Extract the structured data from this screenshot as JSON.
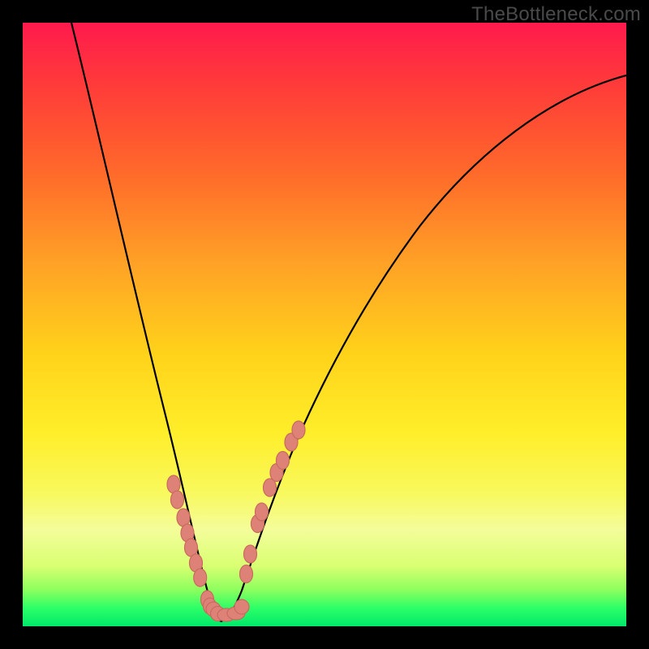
{
  "watermark": "TheBottleneck.com",
  "colors": {
    "frame": "#000000",
    "gradient_top": "#ff1a4d",
    "gradient_bottom": "#00e86a",
    "curve": "#000000",
    "marker_fill": "#de8277",
    "marker_stroke": "#c96a5f"
  },
  "chart_data": {
    "type": "line",
    "title": "",
    "xlabel": "",
    "ylabel": "",
    "xlim": [
      0,
      100
    ],
    "ylim": [
      0,
      100
    ],
    "series": [
      {
        "name": "left-curve",
        "x": [
          8,
          10,
          12,
          14,
          16,
          18,
          20,
          22,
          23,
          24,
          25,
          26,
          27,
          28,
          29,
          30,
          31,
          32
        ],
        "y": [
          100,
          88,
          77,
          67,
          58,
          49,
          41,
          33,
          29,
          25,
          21,
          17,
          14,
          11,
          8,
          5,
          3,
          2
        ]
      },
      {
        "name": "right-curve",
        "x": [
          32,
          33,
          34,
          35,
          36,
          37,
          38,
          40,
          42,
          45,
          48,
          52,
          56,
          60,
          65,
          70,
          76,
          82,
          88,
          94,
          100
        ],
        "y": [
          2,
          3,
          5,
          8,
          11,
          14,
          17,
          22,
          27,
          33,
          39,
          46,
          52,
          57,
          63,
          68,
          73,
          77,
          80,
          83,
          85
        ]
      },
      {
        "name": "markers-left-cluster",
        "x": [
          25.0,
          25.6,
          26.6,
          27.3,
          27.9,
          28.7,
          29.4,
          30.6,
          31.0,
          31.6,
          32.3,
          33.0
        ],
        "y": [
          23.5,
          21.0,
          18.0,
          15.5,
          13.0,
          10.5,
          8.0,
          4.5,
          3.4,
          2.8,
          2.1,
          2.0
        ]
      },
      {
        "name": "markers-right-cluster",
        "x": [
          34.3,
          35.0,
          37.0,
          37.7,
          38.9,
          39.6,
          40.9,
          42.1,
          43.1,
          44.5,
          45.7
        ],
        "y": [
          2.0,
          3.2,
          8.7,
          12.0,
          17.0,
          19.0,
          23.0,
          25.5,
          27.5,
          30.5,
          32.5
        ]
      }
    ],
    "annotations": [
      {
        "text": "TheBottleneck.com",
        "position": "top-right"
      }
    ]
  }
}
